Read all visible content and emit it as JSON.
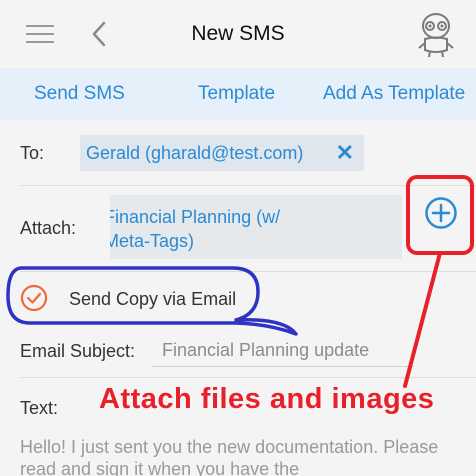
{
  "header": {
    "title": "New SMS",
    "menu_icon": "hamburger-menu-icon",
    "back_icon": "chevron-left-icon",
    "robot_icon": "robot-mascot-icon"
  },
  "actions": {
    "send_sms": "Send SMS",
    "template": "Template",
    "add_as_template": "Add As Template"
  },
  "form": {
    "to_label": "To:",
    "recipient": "Gerald (gharald@test.com)",
    "remove_icon": "✕",
    "attach_label": "Attach:",
    "attachment_line1": "Financial Planning (w/",
    "attachment_line2": "Meta-Tags)",
    "send_copy_label": "Send Copy via Email",
    "send_copy_checked": true,
    "subject_label": "Email Subject:",
    "subject_value": "Financial Planning update",
    "text_label": "Text:",
    "message_text": "Hello! I just sent you the new documentation. Please read and sign it when you have the"
  },
  "annotation": {
    "text": "Attach files and images",
    "color": "#e8202a",
    "outline_color": "#2e33c4"
  },
  "colors": {
    "accent": "#2a8ad4",
    "check_orange": "#f2663c"
  }
}
